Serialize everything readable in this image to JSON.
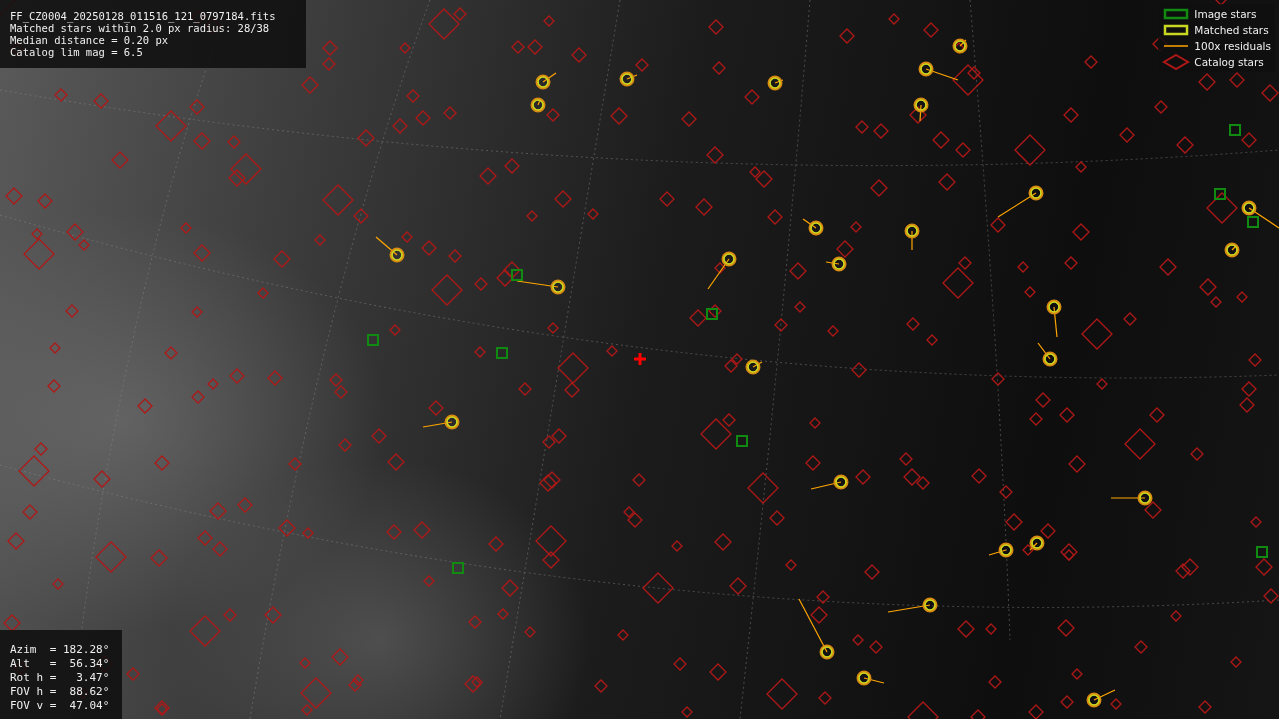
{
  "info_panel": {
    "lines": [
      "FF_CZ0004_20250128_011516_121_0797184.fits",
      "Matched stars within 2.0 px radius: 28/38",
      "Median distance = 0.20 px",
      "Catalog lim mag = 6.5"
    ]
  },
  "legend": [
    {
      "kind": "image",
      "label": "Image stars"
    },
    {
      "kind": "matched",
      "label": "Matched stars"
    },
    {
      "kind": "residual",
      "label": "100x residuals"
    },
    {
      "kind": "catalog",
      "label": "Catalog stars"
    }
  ],
  "pointing_panel": {
    "lines": [
      "Azim  = 182.28°",
      "Alt   =  56.34°",
      "Rot h =   3.47°",
      "FOV h =  88.62°",
      "FOV v =  47.04°"
    ]
  }
}
